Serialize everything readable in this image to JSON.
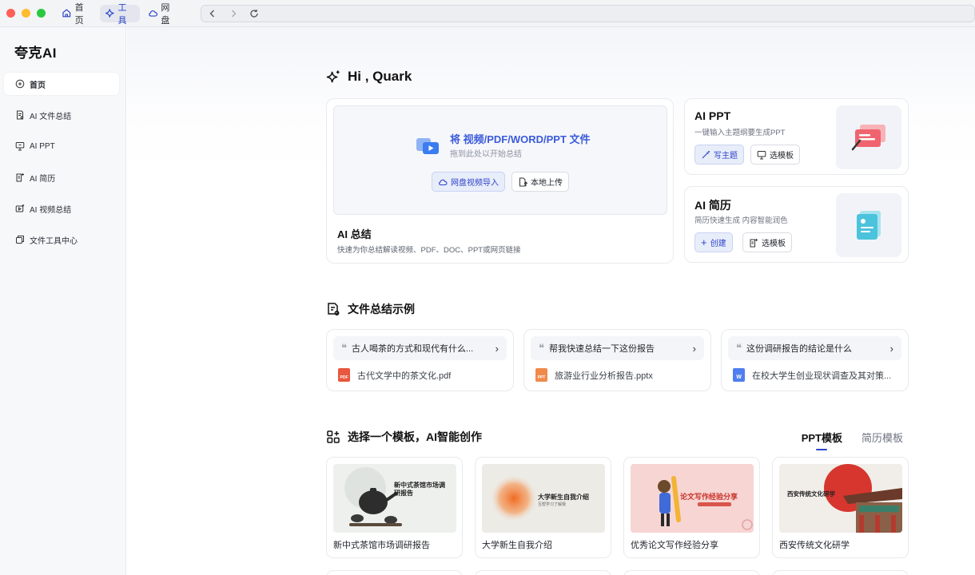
{
  "titlebar": {
    "tabs": [
      {
        "label": "首页",
        "icon": "home-icon"
      },
      {
        "label": "工具",
        "icon": "sparkle-icon"
      },
      {
        "label": "网盘",
        "icon": "cloud-icon"
      }
    ]
  },
  "sidebar": {
    "brand": "夸克AI",
    "items": [
      {
        "label": "首页",
        "icon": "home-icon"
      },
      {
        "label": "AI 文件总结",
        "icon": "file-summary-icon"
      },
      {
        "label": "AI PPT",
        "icon": "presentation-icon"
      },
      {
        "label": "AI 简历",
        "icon": "resume-icon"
      },
      {
        "label": "AI 视频总结",
        "icon": "video-summary-icon"
      },
      {
        "label": "文件工具中心",
        "icon": "file-tools-icon"
      }
    ]
  },
  "main": {
    "greeting": "Hi , Quark",
    "summary": {
      "drop_title": "将 视频/PDF/WORD/PPT 文件",
      "drop_sub": "拖到此处以开始总结",
      "cloud_btn": "网盘视频导入",
      "local_btn": "本地上传",
      "title": "AI 总结",
      "desc": "快速为你总结解读视频、PDF、DOC、PPT或网页链接"
    },
    "ppt": {
      "title": "AI PPT",
      "sub": "一键输入主题纲要生成PPT",
      "primary_btn": "写主题",
      "secondary_btn": "选模板"
    },
    "resume": {
      "title": "AI 简历",
      "sub": "简历快速生成 内容智能润色",
      "primary_btn": "创建",
      "secondary_btn": "选模板"
    },
    "examples_title": "文件总结示例",
    "examples": [
      {
        "question": "古人喝茶的方式和现代有什么...",
        "file": "古代文学中的茶文化.pdf",
        "type": "PDF",
        "color": "#e8573f"
      },
      {
        "question": "帮我快速总结一下这份报告",
        "file": "旅游业行业分析报告.pptx",
        "type": "PPT",
        "color": "#f08a4b"
      },
      {
        "question": "这份调研报告的结论是什么",
        "file": "在校大学生创业现状调查及其对策...",
        "type": "W",
        "color": "#4f7ef0"
      }
    ],
    "templates_title": "选择一个模板，AI智能创作",
    "template_tabs": [
      "PPT模板",
      "简历模板"
    ],
    "templates": [
      {
        "label": "新中式茶馆市场调研报告",
        "thumb_title": "新中式茶馆市场调研报告"
      },
      {
        "label": "大学新生自我介绍",
        "thumb_title": "大学新生自我介绍",
        "thumb_sub": "互帮学习了解我"
      },
      {
        "label": "优秀论文写作经验分享",
        "thumb_title": "论文写作经验分享"
      },
      {
        "label": "西安传统文化研学",
        "thumb_title": "西安传统文化研学"
      }
    ]
  }
}
